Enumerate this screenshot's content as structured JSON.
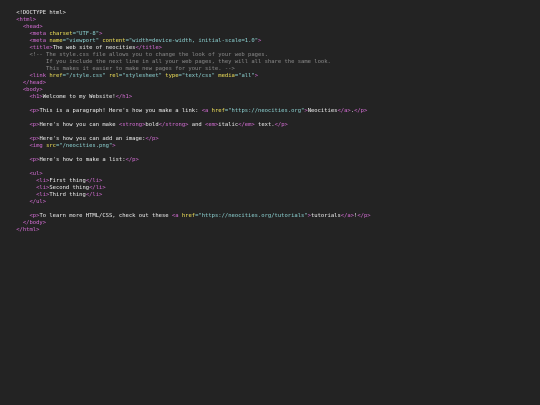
{
  "code": {
    "l1": "<!DOCTYPE html>",
    "l2": "<html>",
    "l3": "  <head>",
    "l4a": "    <meta ",
    "l4b": "charset",
    "l4c": "=\"UTF-8\"",
    "l4d": ">",
    "l5a": "    <meta ",
    "l5b": "name",
    "l5c": "=\"viewport\" ",
    "l5d": "content",
    "l5e": "=\"width=device-width, initial-scale=1.0\"",
    "l5f": ">",
    "l6a": "    <title>",
    "l6b": "The web site of neocities",
    "l6c": "</title>",
    "l7": "    <!-- The style.css file allows you to change the look of your web pages.",
    "l8": "         If you include the next line in all your web pages, they will all share the same look.",
    "l9": "         This makes it easier to make new pages for your site. -->",
    "l10a": "    <link ",
    "l10b": "href",
    "l10c": "=\"/style.css\" ",
    "l10d": "rel",
    "l10e": "=\"stylesheet\" ",
    "l10f": "type",
    "l10g": "=\"text/css\" ",
    "l10h": "media",
    "l10i": "=\"all\"",
    "l10j": ">",
    "l11": "  </head>",
    "l12": "  <body>",
    "l13a": "    <h1>",
    "l13b": "Welcome to my Website!",
    "l13c": "</h1>",
    "l15a": "    <p>",
    "l15b": "This is a paragraph! Here's how you make a link: ",
    "l15c": "<a ",
    "l15d": "href",
    "l15e": "=\"https://neocities.org\"",
    "l15f": ">",
    "l15g": "Neocities",
    "l15h": "</a>",
    "l15i": ".",
    "l15j": "</p>",
    "l17a": "    <p>",
    "l17b": "Here's how you can make ",
    "l17c": "<strong>",
    "l17d": "bold",
    "l17e": "</strong>",
    "l17f": " and ",
    "l17g": "<em>",
    "l17h": "italic",
    "l17i": "</em>",
    "l17j": " text.",
    "l17k": "</p>",
    "l19a": "    <p>",
    "l19b": "Here's how you can add an image:",
    "l19c": "</p>",
    "l20a": "    <img ",
    "l20b": "src",
    "l20c": "=\"/neocities.png\"",
    "l20d": ">",
    "l22a": "    <p>",
    "l22b": "Here's how to make a list:",
    "l22c": "</p>",
    "l24": "    <ul>",
    "l25a": "      <li>",
    "l25b": "First thing",
    "l25c": "</li>",
    "l26a": "      <li>",
    "l26b": "Second thing",
    "l26c": "</li>",
    "l27a": "      <li>",
    "l27b": "Third thing",
    "l27c": "</li>",
    "l28": "    </ul>",
    "l30a": "    <p>",
    "l30b": "To learn more HTML/CSS, check out these ",
    "l30c": "<a ",
    "l30d": "href",
    "l30e": "=\"https://neocities.org/tutorials\"",
    "l30f": ">",
    "l30g": "tutorials",
    "l30h": "</a>",
    "l30i": "!",
    "l30j": "</p>",
    "l31": "  </body>",
    "l32": "</html>"
  }
}
